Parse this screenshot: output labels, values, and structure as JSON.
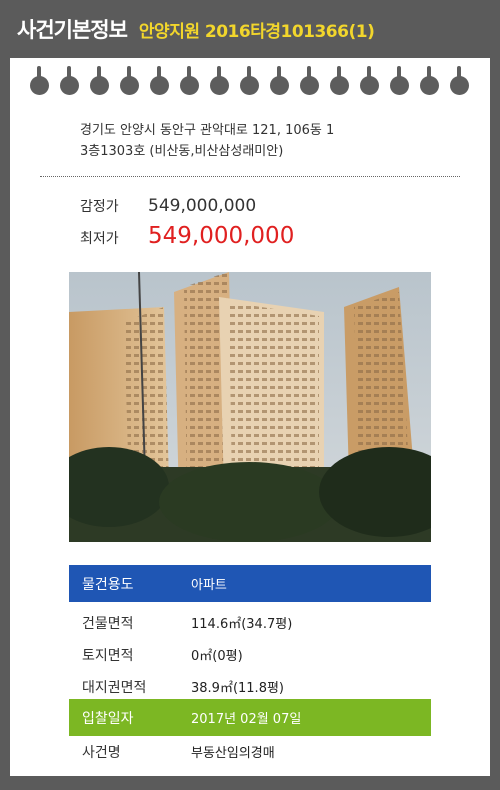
{
  "header": {
    "title": "사건기본정보",
    "case_number": "안양지원 2016타경101366(1)"
  },
  "property": {
    "address_line1": "경기도 안양시 동안구 관악대로 121, 106동 1",
    "address_line2": "3층1303호 (비산동,비산삼성래미안)",
    "appraisal_label": "감정가",
    "appraisal_value": "549,000,000",
    "minimum_label": "최저가",
    "minimum_value": "549,000,000"
  },
  "details": [
    {
      "label": "물건용도",
      "value": "아파트"
    },
    {
      "label": "건물면적",
      "value": "114.6㎡(34.7평)"
    },
    {
      "label": "토지면적",
      "value": "0㎡(0평)"
    },
    {
      "label": "대지권면적",
      "value": "38.9㎡(11.8평)"
    },
    {
      "label": "입찰일자",
      "value": "2017년 02월 07일"
    },
    {
      "label": "사건명",
      "value": "부동산임의경매"
    }
  ],
  "colors": {
    "background": "#5b5b5b",
    "case_number": "#f2d62c",
    "minimum_price": "#e02020",
    "usage_row": "#1f56b4",
    "bid_date_row": "#7cb723"
  },
  "photo": {
    "icon": "apartment-building-photo"
  }
}
